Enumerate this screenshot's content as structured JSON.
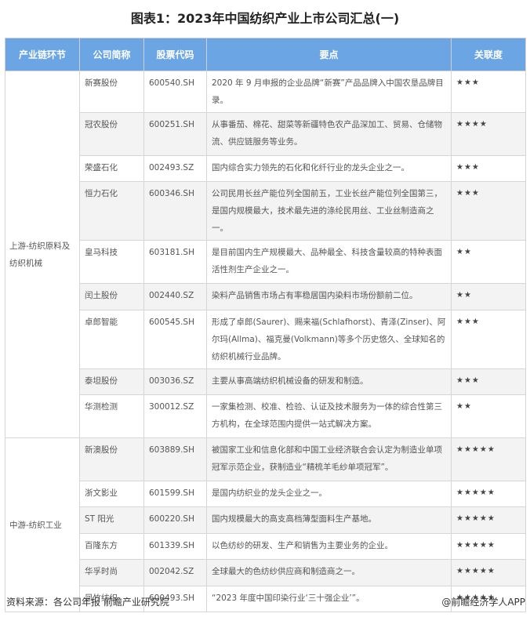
{
  "title": "图表1：2023年中国纺织产业上市公司汇总(一)",
  "headers": [
    "产业链环节",
    "公司简称",
    "股票代码",
    "要点",
    "关联度"
  ],
  "segments": [
    "上游-纺织原料及纺织机械",
    "中游-纺织工业"
  ],
  "rows": [
    {
      "name": "新赛股份",
      "code": "600540.SH",
      "point": "2020 年 9 月申报的企业品牌“新赛”产品品牌入中国农垦品牌目录。",
      "stars": "★★★"
    },
    {
      "name": "冠农股份",
      "code": "600251.SH",
      "point": "从事番茄、棉花、甜菜等新疆特色农产品深加工、贸易、仓储物流、供应链服务等业务。",
      "stars": "★★★★"
    },
    {
      "name": "荣盛石化",
      "code": "002493.SZ",
      "point": "国内综合实力领先的石化和化纤行业的龙头企业之一。",
      "stars": "★★★"
    },
    {
      "name": "恒力石化",
      "code": "600346.SH",
      "point": "公司民用长丝产能位列全国前五，工业长丝产能位列全国第三，是国内规模最大，技术最先进的涤纶民用丝、工业丝制造商之一。",
      "stars": "★★★"
    },
    {
      "name": "皇马科技",
      "code": "603181.SH",
      "point": "是目前国内生产规模最大、品种最全、科技含量较高的特种表面活性剂生产企业之一。",
      "stars": "★★"
    },
    {
      "name": "闰土股份",
      "code": "002440.SZ",
      "point": "染料产品销售市场占有率稳居国内染料市场份额前二位。",
      "stars": "★★"
    },
    {
      "name": "卓郎智能",
      "code": "600545.SH",
      "point": "形成了卓郎(Saurer)、赐来福(Schlafhorst)、青泽(Zinser)、阿尔玛(Allma)、福克曼(Volkmann)等多个历史悠久、全球知名的纺织机械行业品牌。",
      "stars": "★★★"
    },
    {
      "name": "泰坦股份",
      "code": "003036.SZ",
      "point": "主要从事高端纺织机械设备的研发和制造。",
      "stars": "★★★"
    },
    {
      "name": "华测检测",
      "code": "300012.SZ",
      "point": "一家集检测、校准、检验、认证及技术服务为一体的综合性第三方机构，在全球范围内提供一站式解决方案。",
      "stars": "★★"
    },
    {
      "name": "新澳股份",
      "code": "603889.SH",
      "point": "被国家工业和信息化部和中国工业经济联合会认定为制造业单项冠军示范企业，获制造业“精梳羊毛纱单项冠军”。",
      "stars": "★★★★★"
    },
    {
      "name": "浙文影业",
      "code": "601599.SH",
      "point": "是国内纺织业的龙头企业之一。",
      "stars": "★★★★★"
    },
    {
      "name": "ST 阳光",
      "code": "600220.SH",
      "point": "国内规模最大的高支高档薄型面料生产基地。",
      "stars": "★★★★★"
    },
    {
      "name": "百隆东方",
      "code": "601339.SH",
      "point": "以色纺纱的研发、生产和销售为主要业务的企业。",
      "stars": "★★★★★"
    },
    {
      "name": "华孚时尚",
      "code": "002042.SZ",
      "point": "全球最大的色纺纱供应商和制造商之一。",
      "stars": "★★★★★"
    },
    {
      "name": "凤竹纺织",
      "code": "600493.SH",
      "point": "“2023 年度中国印染行业‘三十强企业’”。",
      "stars": "★★★★★"
    }
  ],
  "footer": {
    "source": "资料来源：各公司年报 前瞻产业研究院",
    "brand": "@前瞻经济学人APP"
  }
}
